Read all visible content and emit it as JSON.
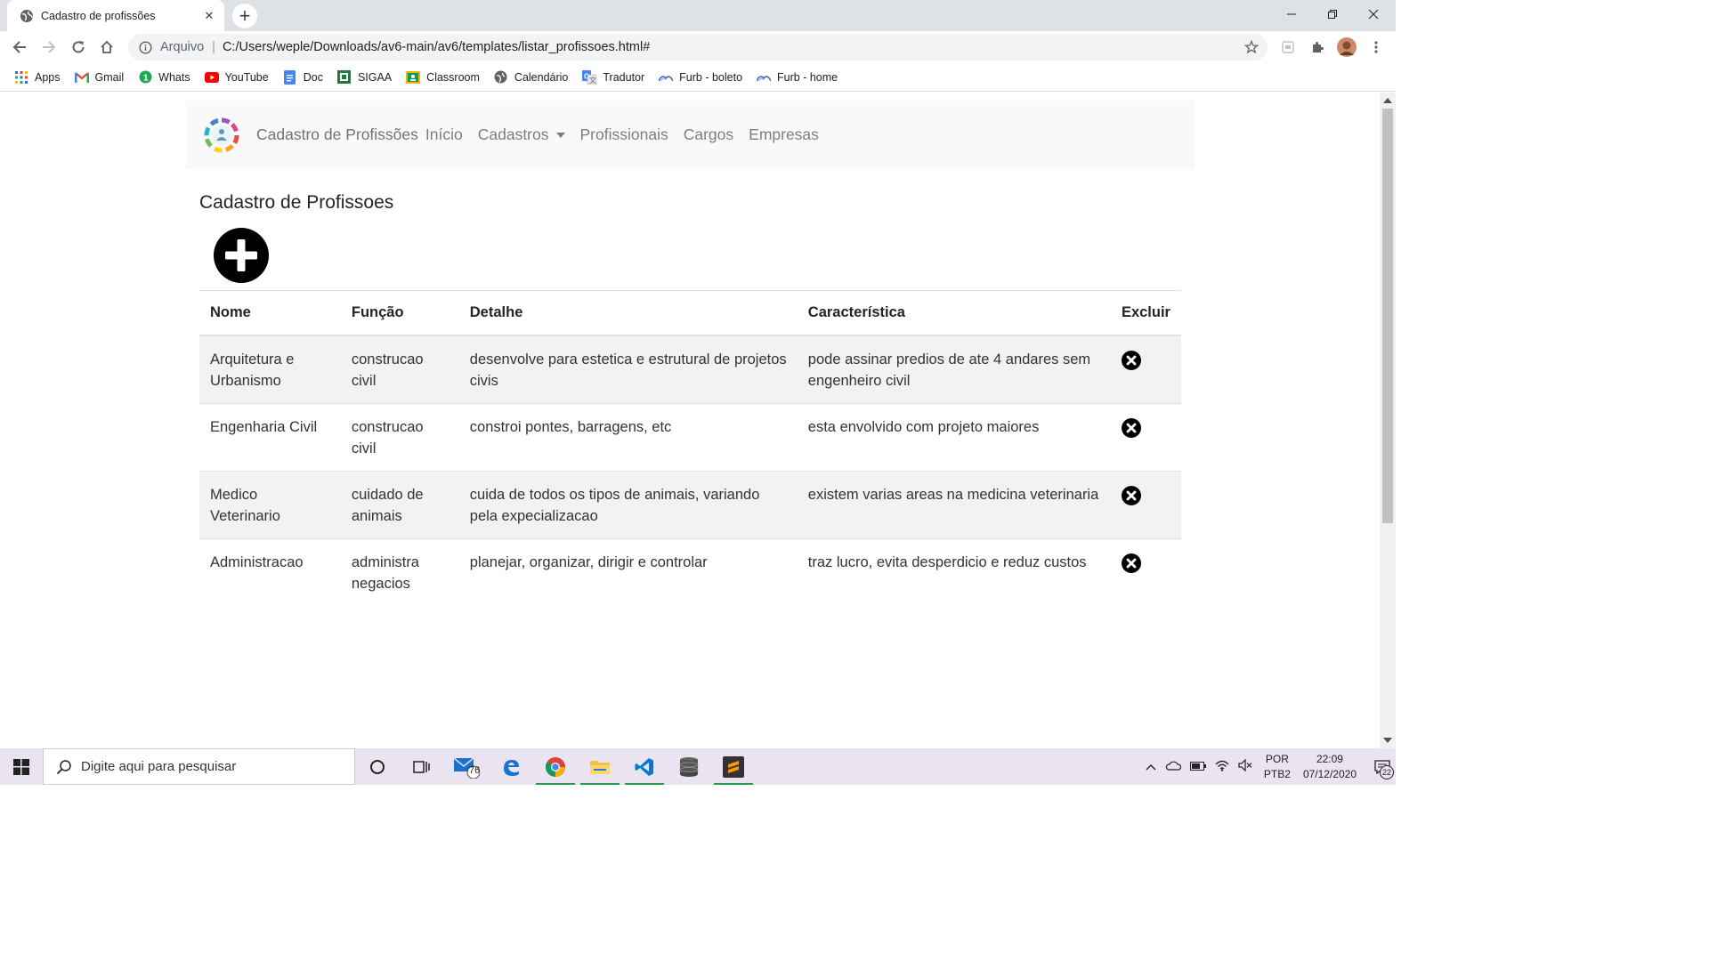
{
  "browser": {
    "tab_title": "Cadastro de profissões",
    "omnibox_scheme_label": "Arquivo",
    "omnibox_separator": "|",
    "url": "C:/Users/weple/Downloads/av6-main/av6/templates/listar_profissoes.html#",
    "bookmarks": [
      {
        "label": "Apps",
        "icon": "apps-grid-icon"
      },
      {
        "label": "Gmail",
        "icon": "gmail-icon"
      },
      {
        "label": "Whats",
        "icon": "whatsapp-icon"
      },
      {
        "label": "YouTube",
        "icon": "youtube-icon"
      },
      {
        "label": "Doc",
        "icon": "docs-icon"
      },
      {
        "label": "SIGAA",
        "icon": "sigaa-icon"
      },
      {
        "label": "Classroom",
        "icon": "classroom-icon"
      },
      {
        "label": "Calendário",
        "icon": "globe-icon"
      },
      {
        "label": "Tradutor",
        "icon": "translate-icon"
      },
      {
        "label": "Furb -  boleto",
        "icon": "furb-icon"
      },
      {
        "label": "Furb - home",
        "icon": "furb-icon"
      }
    ]
  },
  "navbar": {
    "brand": "Cadastro de Profissões",
    "links": [
      "Início",
      "Cadastros",
      "Profissionais",
      "Cargos",
      "Empresas"
    ]
  },
  "main": {
    "title": "Cadastro de Profissoes",
    "table": {
      "headers": [
        "Nome",
        "Função",
        "Detalhe",
        "Característica",
        "Excluir"
      ],
      "rows": [
        {
          "nome": "Arquitetura e Urbanismo",
          "funcao": "construcao civil",
          "detalhe": "desenvolve para estetica e estrutural de projetos civis",
          "caracteristica": "pode assinar predios de ate 4 andares sem engenheiro civil"
        },
        {
          "nome": "Engenharia Civil",
          "funcao": "construcao civil",
          "detalhe": "constroi pontes, barragens, etc",
          "caracteristica": "esta envolvido com projeto maiores"
        },
        {
          "nome": "Medico Veterinario",
          "funcao": "cuidado de animais",
          "detalhe": "cuida de todos os tipos de animais, variando pela expecializacao",
          "caracteristica": "existem varias areas na medicina veterinaria"
        },
        {
          "nome": "Administracao",
          "funcao": "administra negacios",
          "detalhe": "planejar, organizar, dirigir e controlar",
          "caracteristica": "traz lucro, evita desperdicio e reduz custos"
        }
      ]
    }
  },
  "taskbar": {
    "search_placeholder": "Digite aqui para pesquisar",
    "mail_badge": "76",
    "lang_top": "POR",
    "lang_bottom": "PTB2",
    "time": "22:09",
    "date": "07/12/2020",
    "notifications": "22"
  }
}
